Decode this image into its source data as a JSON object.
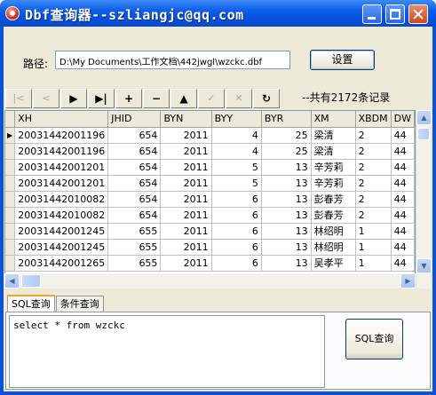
{
  "window": {
    "title": "Dbf查询器--szliangjc@qq.com"
  },
  "path": {
    "label": "路径:",
    "value": "D:\\My Documents\\工作文档\\442jwgl\\wzckc.dbf",
    "set_button": "设置"
  },
  "navigator": {
    "first": "|<",
    "prior": "<",
    "next": "▶",
    "last": "▶|",
    "insert": "+",
    "delete": "−",
    "edit": "▲",
    "post": "✓",
    "cancel": "✕",
    "refresh": "↻",
    "record_count": "--共有2172条记录"
  },
  "grid": {
    "columns": [
      "XH",
      "JHID",
      "BYN",
      "BYY",
      "BYR",
      "XM",
      "XBDM",
      "DW"
    ],
    "rows": [
      [
        "20031442001196",
        "654",
        "2011",
        "4",
        "25",
        "梁清",
        "2",
        "44"
      ],
      [
        "20031442001196",
        "654",
        "2011",
        "4",
        "25",
        "梁清",
        "2",
        "44"
      ],
      [
        "20031442001201",
        "654",
        "2011",
        "5",
        "13",
        "辛芳莉",
        "2",
        "44"
      ],
      [
        "20031442001201",
        "654",
        "2011",
        "5",
        "13",
        "辛芳莉",
        "2",
        "44"
      ],
      [
        "20031442010082",
        "654",
        "2011",
        "6",
        "13",
        "彭春芳",
        "2",
        "44"
      ],
      [
        "20031442010082",
        "654",
        "2011",
        "6",
        "13",
        "彭春芳",
        "2",
        "44"
      ],
      [
        "20031442001245",
        "655",
        "2011",
        "6",
        "13",
        "林绍明",
        "1",
        "44"
      ],
      [
        "20031442001245",
        "655",
        "2011",
        "6",
        "13",
        "林绍明",
        "1",
        "44"
      ],
      [
        "20031442001265",
        "655",
        "2011",
        "6",
        "13",
        "吴孝平",
        "1",
        "44"
      ]
    ]
  },
  "tabs": [
    "SQL查询",
    "条件查询"
  ],
  "query": {
    "text": "select * from wzckc",
    "button": "SQL查询"
  },
  "colors": {
    "titlebar": "#0a53d6",
    "face": "#ece9d8",
    "tab_highlight": "#f5a326"
  }
}
